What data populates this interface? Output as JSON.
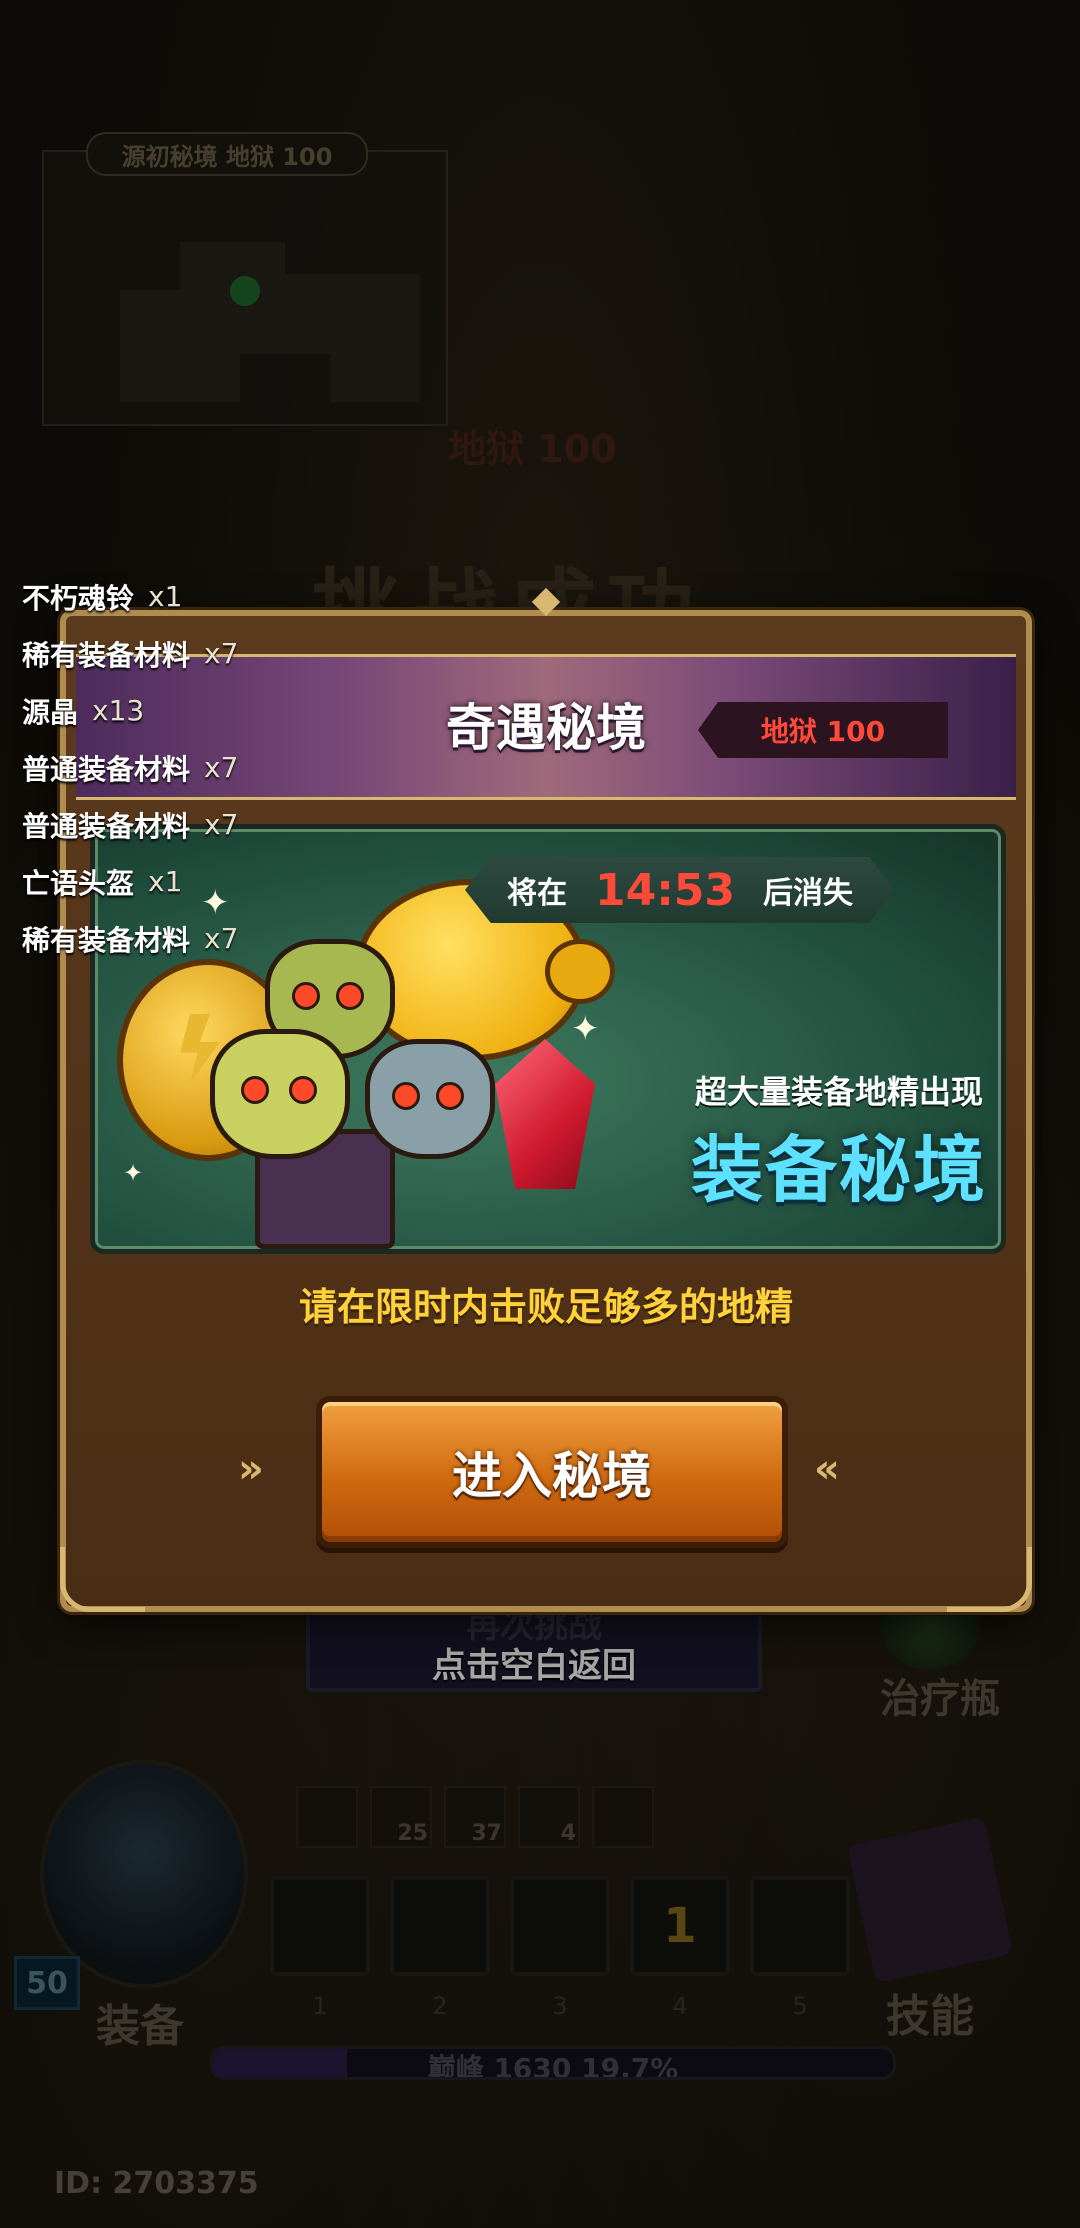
{
  "background": {
    "map_title": "源初秘境 地狱 100",
    "level_text": "地狱 100",
    "result_text": "挑战成功",
    "retry_label": "再次挑战",
    "back_hint": "点击空白返回",
    "potion_label": "治疗瓶",
    "equip_label": "装备",
    "skill_label": "技能",
    "player_level": "50",
    "buff_counts": [
      "",
      "25",
      "37",
      "4",
      ""
    ],
    "slot_numbers": [
      "1",
      "2",
      "3",
      "4",
      "5"
    ],
    "slot_badge": "1",
    "xp_text": "巅峰 1630   19.7%",
    "xp_fraction": 0.197,
    "player_id": "ID: 2703375"
  },
  "rewards": [
    {
      "name": "不朽魂铃",
      "qty": "x1",
      "color": "#ffffff"
    },
    {
      "name": "稀有装备材料",
      "qty": "x7",
      "color": "#ffffff"
    },
    {
      "name": "源晶",
      "qty": "x13",
      "color": "#ffffff"
    },
    {
      "name": "普通装备材料",
      "qty": "x7",
      "color": "#ffffff"
    },
    {
      "name": "普通装备材料",
      "qty": "x7",
      "color": "#ffffff"
    },
    {
      "name": "亡语头盔",
      "qty": "x1",
      "color": "#ffffff"
    },
    {
      "name": "稀有装备材料",
      "qty": "x7",
      "color": "#ffffff"
    }
  ],
  "modal": {
    "title": "奇遇秘境",
    "difficulty": "地狱 100",
    "timer_prefix": "将在",
    "timer_value": "14:53",
    "timer_suffix": "后消失",
    "banner_subtitle": "超大量装备地精出现",
    "banner_title": "装备秘境",
    "instruction": "请在限时内击败足够多的地精",
    "enter_button": "进入秘境"
  },
  "colors": {
    "accent_gold": "#d8b870",
    "timer_red": "#ff4a3a",
    "banner_title": "#5ee0ff",
    "instruction": "#ffd23a",
    "button_orange": "#d06a10"
  }
}
